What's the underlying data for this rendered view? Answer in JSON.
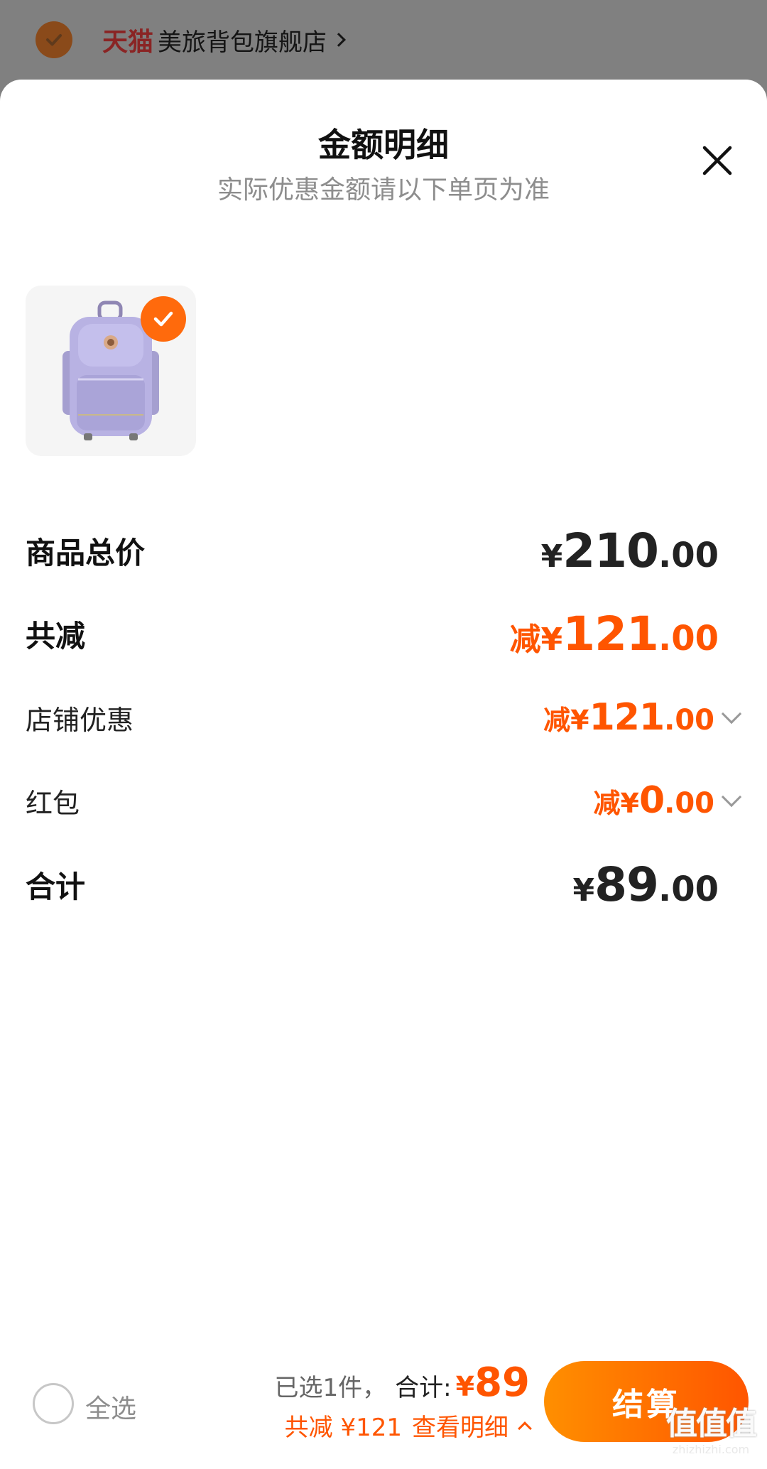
{
  "store": {
    "brand": "天猫",
    "name": "美旅背包旗舰店"
  },
  "sheet": {
    "title": "金额明细",
    "subtitle": "实际优惠金额请以下单页为准"
  },
  "summary": {
    "total_label": "商品总价",
    "total_prefix": "¥",
    "total_int": "210",
    "total_dec": ".00",
    "reduce_label": "共减",
    "reduce_prefix": "减¥",
    "reduce_int": "121",
    "reduce_dec": ".00",
    "shop_label": "店铺优惠",
    "shop_prefix": "减¥",
    "shop_int": "121",
    "shop_dec": ".00",
    "redpacket_label": "红包",
    "redpacket_prefix": "减¥",
    "redpacket_int": "0",
    "redpacket_dec": ".00",
    "sum_label": "合计",
    "sum_prefix": "¥",
    "sum_int": "89",
    "sum_dec": ".00"
  },
  "bottom_bar": {
    "select_all": "全选",
    "selected": "已选1件，",
    "sum_label": "合计:",
    "sum_prefix": "¥",
    "sum_value": "89",
    "reduce_text": "共减 ¥121",
    "detail_link": "查看明细",
    "checkout": "结算"
  },
  "watermark": {
    "big": "值值值",
    "small": "zhizhizhi.com"
  },
  "colors": {
    "accent": "#ff5500",
    "accent_light": "#ff8f00",
    "product_bg": "#f5f5f5"
  },
  "icons": [
    "check-icon",
    "close-icon",
    "chevron-right-icon",
    "chevron-down-icon",
    "chevron-up-icon",
    "backpack-image"
  ]
}
